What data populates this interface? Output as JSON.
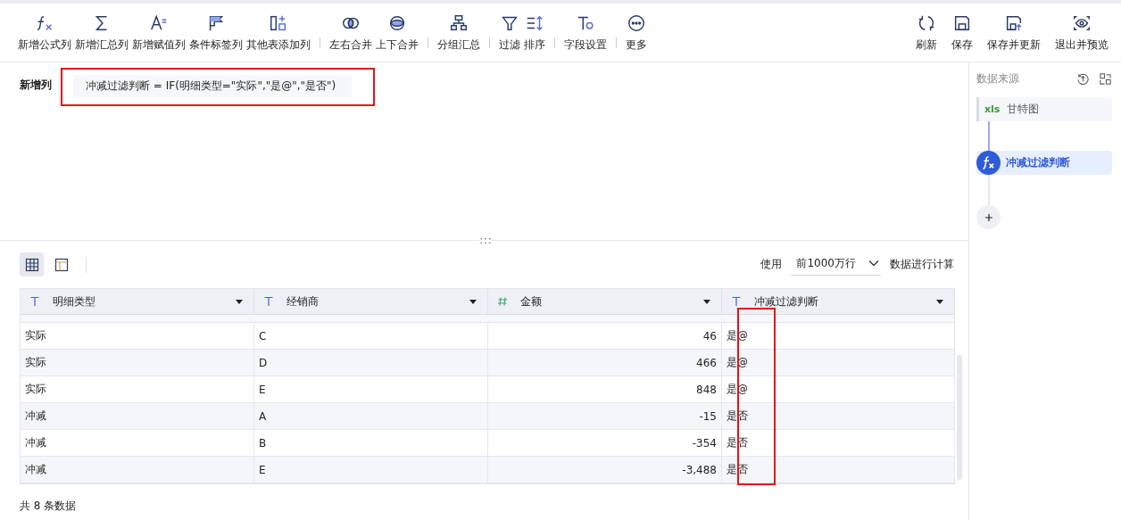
{
  "toolbar": {
    "left": [
      "新增公式列",
      "新增汇总列",
      "新增赋值列",
      "条件标签列",
      "其他表添加列",
      "左右合并",
      "上下合并",
      "分组汇总",
      "过滤",
      "排序",
      "字段设置",
      "更多"
    ],
    "right": [
      "刷新",
      "保存",
      "保存并更新",
      "退出并预览"
    ]
  },
  "formula": {
    "label": "新增列",
    "expression": "冲减过滤判断 = IF(明细类型=\"实际\",\"是@\",\"是否\")"
  },
  "view_switch": [
    {
      "kind": "grid",
      "selected": true
    },
    {
      "kind": "layout",
      "selected": false
    }
  ],
  "row_limit": {
    "prefix": "使用",
    "value": "前1000万行",
    "suffix": "数据进行计算"
  },
  "table": {
    "columns": [
      {
        "name": "明细类型",
        "kind": "text"
      },
      {
        "name": "经销商",
        "kind": "text"
      },
      {
        "name": "金额",
        "kind": "number"
      },
      {
        "name": "冲减过滤判断",
        "kind": "text"
      }
    ],
    "rows": [
      [
        "实际",
        "C",
        "46",
        "是@"
      ],
      [
        "实际",
        "D",
        "466",
        "是@"
      ],
      [
        "实际",
        "E",
        "848",
        "是@"
      ],
      [
        "冲减",
        "A",
        "-15",
        "是否"
      ],
      [
        "冲减",
        "B",
        "-354",
        "是否"
      ],
      [
        "冲减",
        "E",
        "-3,488",
        "是否"
      ]
    ]
  },
  "footer": "共 8 条数据",
  "sidebar": {
    "title": "数据来源",
    "source": {
      "badge": "xls",
      "name": "甘特图"
    },
    "steps": [
      {
        "name": "冲减过滤判断",
        "selected": true
      }
    ]
  }
}
